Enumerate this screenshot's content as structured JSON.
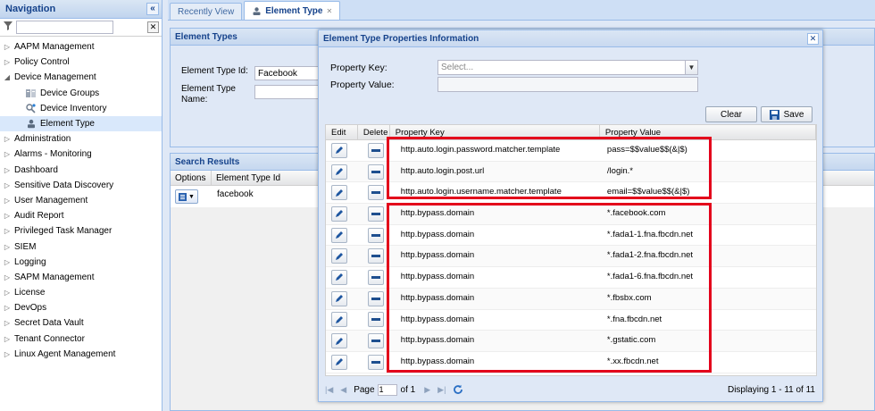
{
  "sidebar": {
    "title": "Navigation",
    "collapse_glyph": "«",
    "filter_placeholder": "",
    "items": [
      {
        "label": "AAPM Management",
        "expanded": false
      },
      {
        "label": "Policy Control",
        "expanded": false
      },
      {
        "label": "Device Management",
        "expanded": true
      },
      {
        "label": "Administration",
        "expanded": false
      },
      {
        "label": "Alarms - Monitoring",
        "expanded": false
      },
      {
        "label": "Dashboard",
        "expanded": false
      },
      {
        "label": "Sensitive Data Discovery",
        "expanded": false
      },
      {
        "label": "User Management",
        "expanded": false
      },
      {
        "label": "Audit Report",
        "expanded": false
      },
      {
        "label": "Privileged Task Manager",
        "expanded": false
      },
      {
        "label": "SIEM",
        "expanded": false
      },
      {
        "label": "Logging",
        "expanded": false
      },
      {
        "label": "SAPM Management",
        "expanded": false
      },
      {
        "label": "License",
        "expanded": false
      },
      {
        "label": "DevOps",
        "expanded": false
      },
      {
        "label": "Secret Data Vault",
        "expanded": false
      },
      {
        "label": "Tenant Connector",
        "expanded": false
      },
      {
        "label": "Linux Agent Management",
        "expanded": false
      }
    ],
    "device_children": [
      {
        "label": "Device Groups",
        "icon": "device-groups-icon"
      },
      {
        "label": "Device Inventory",
        "icon": "device-inventory-icon"
      },
      {
        "label": "Element Type",
        "icon": "element-type-icon",
        "selected": true
      }
    ]
  },
  "tabs": [
    {
      "label": "Recently View",
      "active": false
    },
    {
      "label": "Element Type",
      "active": true
    }
  ],
  "element_types": {
    "title": "Element Types",
    "id_label": "Element Type Id:",
    "id_value": "Facebook",
    "name_label_1": "Element Type",
    "name_label_2": "Name:",
    "name_value": ""
  },
  "search_results": {
    "title": "Search Results",
    "columns": [
      "Options",
      "Element Type Id"
    ],
    "rows": [
      {
        "id": "facebook"
      }
    ]
  },
  "modal": {
    "title": "Element Type Properties Information",
    "key_label": "Property Key:",
    "key_placeholder": "Select...",
    "value_label": "Property Value:",
    "value_value": "",
    "clear_label": "Clear",
    "save_label": "Save",
    "columns": {
      "edit": "Edit",
      "delete": "Delete",
      "key": "Property Key",
      "value": "Property Value"
    },
    "rows": [
      {
        "key": "http.auto.login.password.matcher.template",
        "value": "pass=$$value$$(&|$)"
      },
      {
        "key": "http.auto.login.post.url",
        "value": "/login.*"
      },
      {
        "key": "http.auto.login.username.matcher.template",
        "value": "email=$$value$$(&|$)"
      },
      {
        "key": "http.bypass.domain",
        "value": "*.facebook.com"
      },
      {
        "key": "http.bypass.domain",
        "value": "*.fada1-1.fna.fbcdn.net"
      },
      {
        "key": "http.bypass.domain",
        "value": "*.fada1-2.fna.fbcdn.net"
      },
      {
        "key": "http.bypass.domain",
        "value": "*.fada1-6.fna.fbcdn.net"
      },
      {
        "key": "http.bypass.domain",
        "value": "*.fbsbx.com"
      },
      {
        "key": "http.bypass.domain",
        "value": "*.fna.fbcdn.net"
      },
      {
        "key": "http.bypass.domain",
        "value": "*.gstatic.com"
      },
      {
        "key": "http.bypass.domain",
        "value": "*.xx.fbcdn.net"
      }
    ],
    "pager": {
      "page_label": "Page",
      "page_value": "1",
      "of_label": "of 1",
      "display_text": "Displaying 1 - 11 of 11"
    }
  },
  "colors": {
    "accent": "#15428b",
    "border": "#99bbe8",
    "highlight": "#e3001b"
  }
}
